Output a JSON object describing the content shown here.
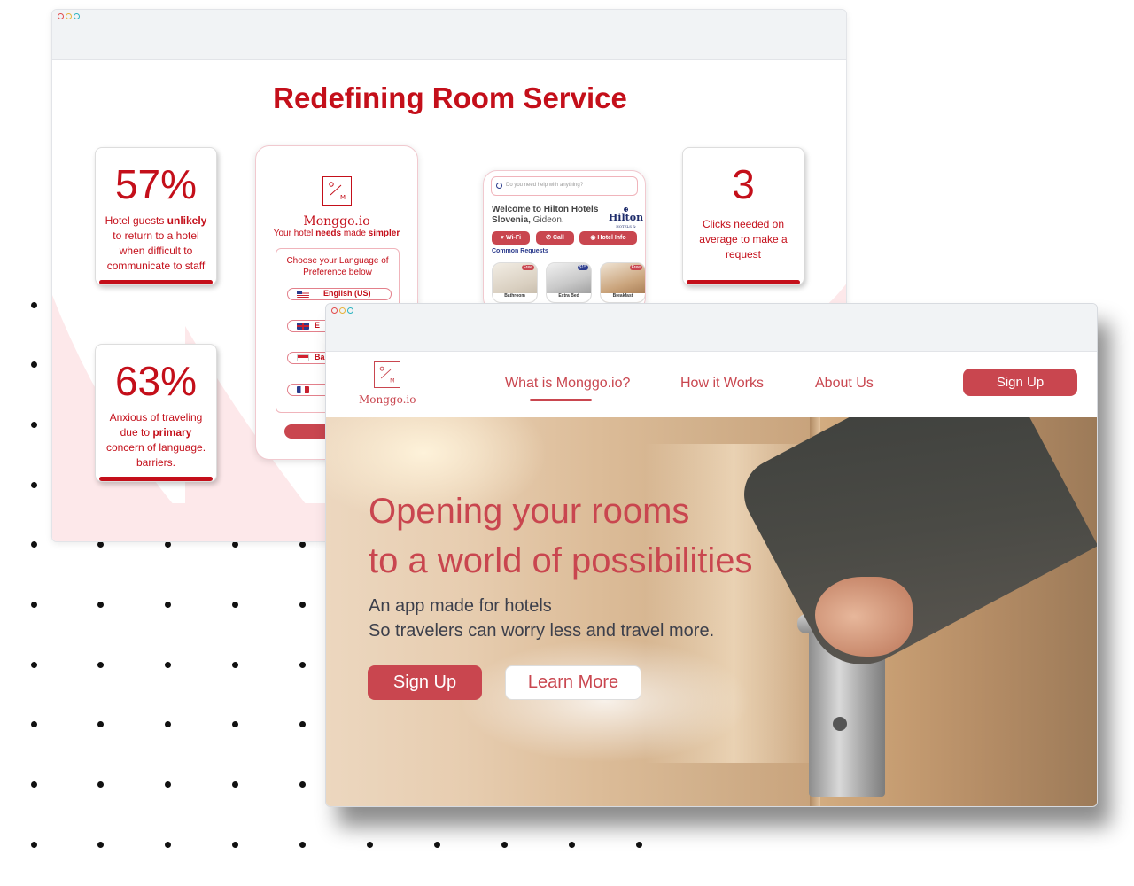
{
  "back_window": {
    "title": "Redefining Room Service",
    "stats": [
      {
        "value": "57%",
        "text_parts": [
          "Hotel guests ",
          "unlikely",
          " to return to a hotel when difficult to communicate to staff"
        ]
      },
      {
        "value": "63%",
        "text_parts": [
          "Anxious of traveling due to ",
          "primary",
          " concern of language. barriers."
        ]
      },
      {
        "value": "3",
        "text": "Clicks needed on average to make a request"
      }
    ],
    "phone_left": {
      "logo_letters": "o/M",
      "brand": "Monggo.io",
      "tagline_parts": [
        "Your hotel ",
        "needs",
        " made ",
        "simpler"
      ],
      "language_heading": "Choose your Language of Preference below",
      "languages": [
        "English (US)",
        "E",
        "Bah",
        ""
      ]
    },
    "phone_right": {
      "search_placeholder": "Do you need help with anything?",
      "welcome_line1": "Welcome to Hilton Hotels",
      "welcome_line2_bold": "Slovenia,",
      "welcome_line2": " Gideon.",
      "hotel_logo": "Hilton",
      "hotel_logo_sub": "HOTELS & RESORTS",
      "pills": [
        "Wi-Fi",
        "Call",
        "Hotel Info"
      ],
      "common_requests": "Common Requests",
      "tiles": [
        "Bathroom",
        "Extra Bed",
        "Breakfast"
      ],
      "tile_badges": [
        "Free",
        "$15",
        "Free"
      ]
    }
  },
  "front_window": {
    "brand": "Monggo.io",
    "logo_letters": "o/M",
    "nav": [
      "What is Monggo.io?",
      "How it Works",
      "About Us"
    ],
    "signup_nav": "Sign Up",
    "hero": {
      "headline_line1": "Opening your rooms",
      "headline_line2": "to a world of possibilities",
      "sub_line1": "An app made for hotels",
      "sub_line2": "So travelers can worry less and travel more.",
      "primary_button": "Sign Up",
      "secondary_button": "Learn More"
    }
  },
  "colors": {
    "brand_red": "#c40f1a",
    "accent_rose": "#c9464f",
    "pink_bg": "#fde8ea"
  }
}
